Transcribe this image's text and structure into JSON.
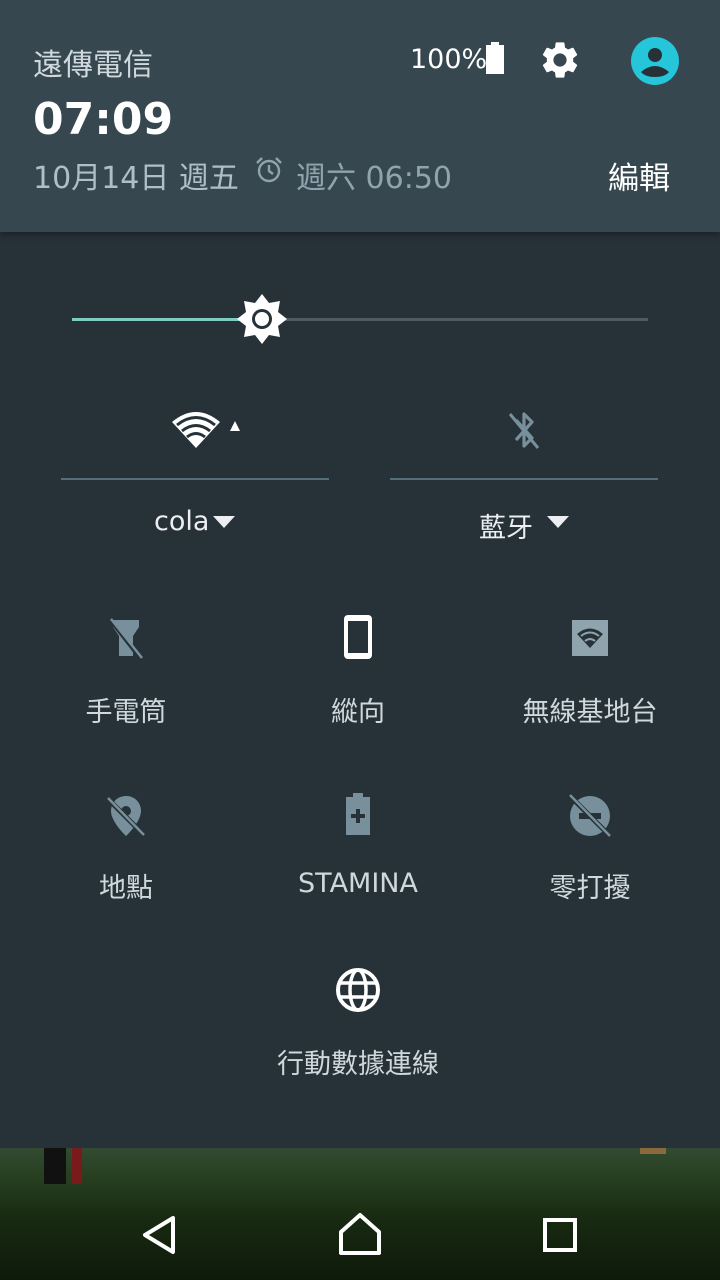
{
  "status": {
    "carrier": "遠傳電信",
    "battery": "100%",
    "time": "07:09",
    "date": "10月14日 週五",
    "alarm": "週六 06:50",
    "edit_label": "編輯"
  },
  "brightness": {
    "level": 0.33
  },
  "connectivity": {
    "wifi": {
      "label": "cola",
      "icon": "wifi-icon"
    },
    "bluetooth": {
      "label": "藍牙",
      "icon": "bluetooth-off-icon"
    }
  },
  "tiles": [
    {
      "label": "手電筒",
      "icon": "flashlight-off-icon"
    },
    {
      "label": "縱向",
      "icon": "phone-portrait-icon"
    },
    {
      "label": "無線基地台",
      "icon": "hotspot-icon"
    },
    {
      "label": "地點",
      "icon": "location-off-icon"
    },
    {
      "label": "STAMINA",
      "icon": "stamina-battery-icon"
    },
    {
      "label": "零打擾",
      "icon": "do-not-disturb-off-icon"
    },
    {
      "label": "行動數據連線",
      "icon": "globe-icon"
    }
  ],
  "colors": {
    "accent": "#80cbc4",
    "header_bg": "#37474f",
    "panel_bg": "#263238",
    "avatar": "#26c6da"
  }
}
